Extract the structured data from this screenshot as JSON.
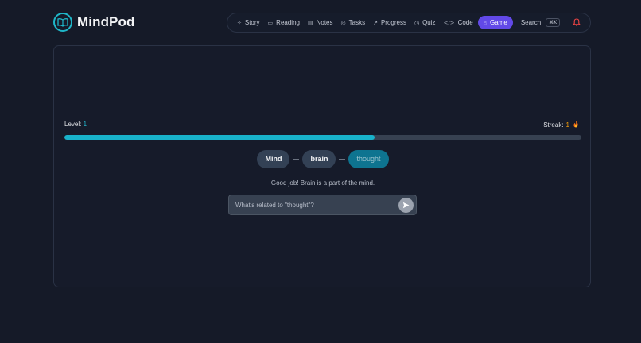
{
  "app": {
    "name": "MindPod"
  },
  "nav": {
    "items": [
      {
        "label": "Story",
        "icon": "rocket-icon",
        "glyph": "✧"
      },
      {
        "label": "Reading",
        "icon": "book-icon",
        "glyph": "▭"
      },
      {
        "label": "Notes",
        "icon": "notes-icon",
        "glyph": "▤"
      },
      {
        "label": "Tasks",
        "icon": "check-circle-icon",
        "glyph": "◎"
      },
      {
        "label": "Progress",
        "icon": "trend-icon",
        "glyph": "↗"
      },
      {
        "label": "Quiz",
        "icon": "help-circle-icon",
        "glyph": "◷"
      },
      {
        "label": "Code",
        "icon": "code-icon",
        "glyph": "</>"
      },
      {
        "label": "Game",
        "icon": "hand-pointer-icon",
        "glyph": "☝",
        "active": true
      }
    ],
    "search_label": "Search",
    "search_shortcut": "⌘K",
    "accent": "#6249e8"
  },
  "game": {
    "level_label": "Level:",
    "level_value": "1",
    "streak_label": "Streak:",
    "streak_value": "1",
    "progress_fraction": 0.6,
    "chain": [
      "Mind",
      "brain",
      "thought"
    ],
    "feedback": "Good job! Brain is a part of the mind.",
    "input": {
      "value": "",
      "placeholder": "What's related to \"thought\"?"
    }
  },
  "colors": {
    "background": "#151a28",
    "accent_cyan": "#18b2ca",
    "current_chip": "#0e7490",
    "alert_red": "#ef4444"
  }
}
